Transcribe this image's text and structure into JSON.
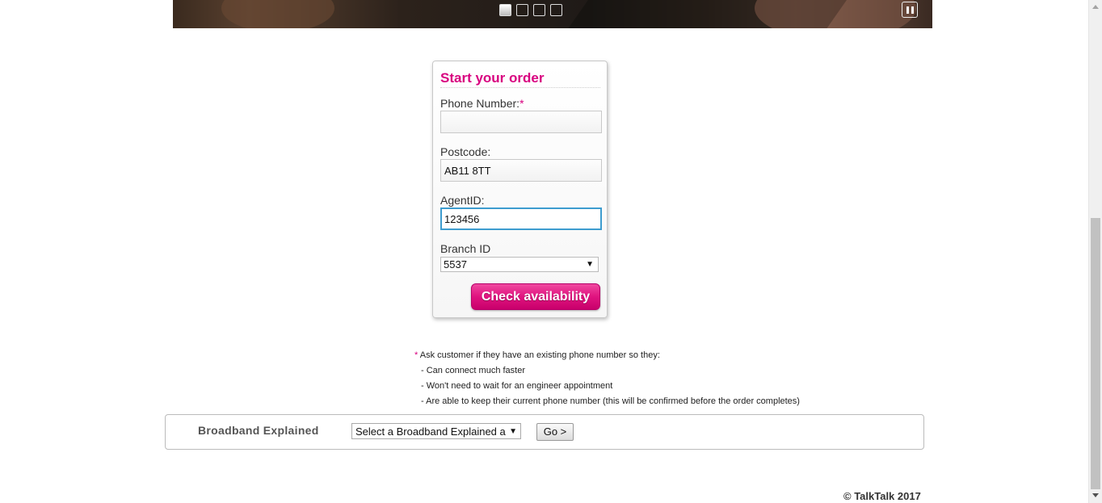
{
  "hero": {
    "slides": [
      "slide-1",
      "slide-2",
      "slide-3",
      "slide-4"
    ],
    "active_slide": 1,
    "pause_icon": "pause-icon"
  },
  "order_form": {
    "title": "Start your order",
    "phone_label": "Phone Number:",
    "required_mark": "*",
    "phone_value": "",
    "postcode_label": "Postcode:",
    "postcode_value": "AB11 8TT",
    "agent_label": "AgentID:",
    "agent_value": "123456",
    "branch_label": "Branch ID",
    "branch_value": "5537",
    "submit_label": "Check availability",
    "accent_color": "#d8007f"
  },
  "notes": {
    "asterisk": "*",
    "intro": " Ask customer if they have an existing phone number so they:",
    "items": [
      "- Can connect much faster",
      "- Won't need to wait for an engineer appointment",
      "- Are able to keep their current phone number (this will be confirmed before the order completes)"
    ]
  },
  "broadband_explained": {
    "label": "Broadband Explained",
    "select_value": "Select a Broadband Explained a",
    "go_label": "Go >"
  },
  "footer": {
    "copyright": "© TalkTalk 2017"
  }
}
